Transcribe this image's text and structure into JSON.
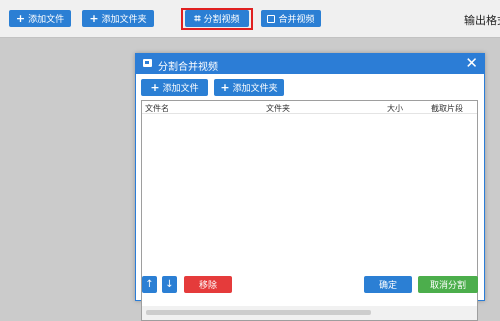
{
  "toolbar": {
    "add_file_label": "添加文件",
    "add_folder_label": "添加文件夹",
    "split_video_label": "分割视频",
    "merge_video_label": "合并视频",
    "output_label": "输出格式"
  },
  "dialog": {
    "title": "分割合并视频",
    "add_file_label": "添加文件",
    "add_folder_label": "添加文件夹",
    "columns": [
      "文件名",
      "文件夹",
      "大小",
      "截取片段"
    ],
    "rows": [],
    "delete_label": "移除",
    "confirm_label": "确定",
    "cancel_label": "取消分割"
  },
  "colors": {
    "accent": "#2b7fd4",
    "danger": "#e53b3b",
    "success": "#4cae4c",
    "highlight": "#e02020"
  }
}
